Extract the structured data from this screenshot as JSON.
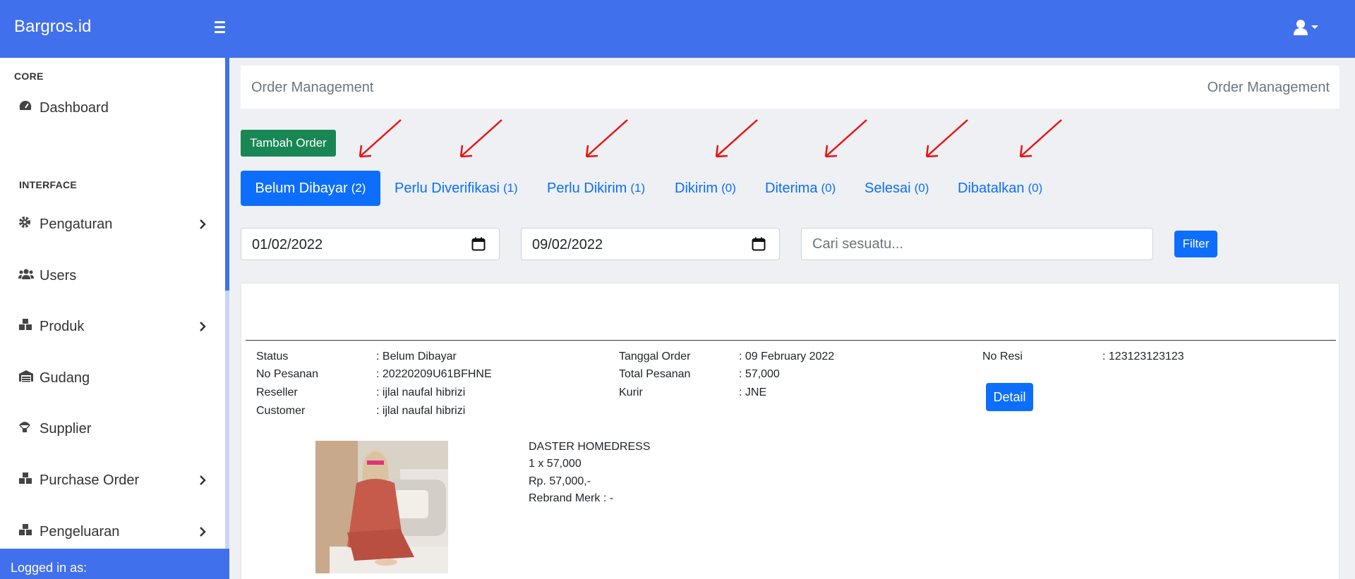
{
  "app": {
    "brand": "Bargros.id"
  },
  "sidebar": {
    "core_heading": "CORE",
    "interface_heading": "INTERFACE",
    "items": [
      {
        "label": "Dashboard",
        "icon": "tachometer-icon",
        "chevron": false
      },
      {
        "label": "Pengaturan",
        "icon": "gear-icon",
        "chevron": true
      },
      {
        "label": "Users",
        "icon": "users-icon",
        "chevron": false
      },
      {
        "label": "Produk",
        "icon": "boxes-icon",
        "chevron": true
      },
      {
        "label": "Gudang",
        "icon": "warehouse-icon",
        "chevron": false
      },
      {
        "label": "Supplier",
        "icon": "parachute-box-icon",
        "chevron": false
      },
      {
        "label": "Purchase Order",
        "icon": "boxes-icon",
        "chevron": true
      },
      {
        "label": "Pengeluaran",
        "icon": "boxes-icon",
        "chevron": true
      }
    ],
    "footer": "Logged in as:"
  },
  "header": {
    "left": "Order Management",
    "right": "Order Management"
  },
  "actions": {
    "add_order": "Tambah Order",
    "filter": "Filter",
    "detail": "Detail"
  },
  "tabs": [
    {
      "label": "Belum Dibayar",
      "count": "(2)",
      "active": true
    },
    {
      "label": "Perlu Diverifikasi",
      "count": "(1)",
      "active": false
    },
    {
      "label": "Perlu Dikirim",
      "count": "(1)",
      "active": false
    },
    {
      "label": "Dikirim",
      "count": "(0)",
      "active": false
    },
    {
      "label": "Diterima",
      "count": "(0)",
      "active": false
    },
    {
      "label": "Selesai",
      "count": "(0)",
      "active": false
    },
    {
      "label": "Dibatalkan",
      "count": "(0)",
      "active": false
    }
  ],
  "filters": {
    "date_from": "01/02/2022",
    "date_to": "09/02/2022",
    "search_placeholder": "Cari sesuatu..."
  },
  "order": {
    "status_label": "Status",
    "status_value": ": Belum Dibayar",
    "no_pesanan_label": "No Pesanan",
    "no_pesanan_value": ": 20220209U61BFHNE",
    "reseller_label": "Reseller",
    "reseller_value": ": ijlal naufal hibrizi",
    "customer_label": "Customer",
    "customer_value": ": ijlal naufal hibrizi",
    "tanggal_label": "Tanggal Order",
    "tanggal_value": ": 09 February 2022",
    "total_label": "Total Pesanan",
    "total_value": ": 57,000",
    "kurir_label": "Kurir",
    "kurir_value": ": JNE",
    "resi_label": "No Resi",
    "resi_value": ": 123123123123",
    "product": {
      "name": "DASTER HOMEDRESS",
      "qty_price": "1 x 57,000",
      "subtotal": "Rp. 57,000,-",
      "rebrand": "Rebrand Merk : -"
    }
  },
  "colors": {
    "primary": "#4170ec",
    "tab_blue": "#0d6efd",
    "success": "#198754",
    "arrow": "#e81313"
  }
}
